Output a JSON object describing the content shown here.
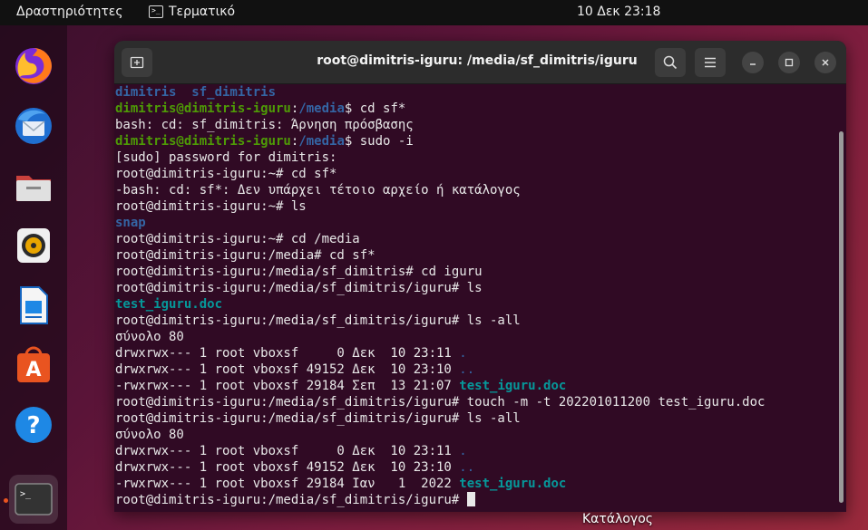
{
  "topbar": {
    "activities": "Δραστηριότητες",
    "app": "Τερματικό",
    "clock": "10 Δεκ  23:18"
  },
  "dock": {
    "items": [
      "firefox-icon",
      "thunderbird-icon",
      "files-icon",
      "rhythmbox-icon",
      "libreoffice-writer-icon",
      "software-icon",
      "help-icon",
      "terminal-icon"
    ]
  },
  "window": {
    "title": "root@dimitris-iguru: /media/sf_dimitris/iguru"
  },
  "terminal": {
    "lines": [
      [
        [
          "dimitris  sf_dimitris",
          "dir"
        ]
      ],
      [
        [
          "dimitris@dimitris-iguru",
          "user"
        ],
        [
          ":",
          "plain"
        ],
        [
          "/media",
          "path"
        ],
        [
          "$ cd sf*",
          "plain"
        ]
      ],
      [
        [
          "bash: cd: sf_dimitris: Άρνηση πρόσβασης",
          "plain"
        ]
      ],
      [
        [
          "dimitris@dimitris-iguru",
          "user"
        ],
        [
          ":",
          "plain"
        ],
        [
          "/media",
          "path"
        ],
        [
          "$ sudo -i",
          "plain"
        ]
      ],
      [
        [
          "[sudo] password for dimitris:",
          "plain"
        ]
      ],
      [
        [
          "root@dimitris-iguru:~# cd sf*",
          "plain"
        ]
      ],
      [
        [
          "-bash: cd: sf*: Δεν υπάρχει τέτοιο αρχείο ή κατάλογος",
          "plain"
        ]
      ],
      [
        [
          "root@dimitris-iguru:~# ls",
          "plain"
        ]
      ],
      [
        [
          "snap",
          "dir"
        ]
      ],
      [
        [
          "root@dimitris-iguru:~# cd /media",
          "plain"
        ]
      ],
      [
        [
          "root@dimitris-iguru:/media# cd sf*",
          "plain"
        ]
      ],
      [
        [
          "root@dimitris-iguru:/media/sf_dimitris# cd iguru",
          "plain"
        ]
      ],
      [
        [
          "root@dimitris-iguru:/media/sf_dimitris/iguru# ls",
          "plain"
        ]
      ],
      [
        [
          "test_iguru.doc",
          "file"
        ]
      ],
      [
        [
          "root@dimitris-iguru:/media/sf_dimitris/iguru# ls -all",
          "plain"
        ]
      ],
      [
        [
          "σύνολο 80",
          "plain"
        ]
      ],
      [
        [
          "drwxrwx--- 1 root vboxsf     0 Δεκ  10 23:11 ",
          "plain"
        ],
        [
          ".",
          "other"
        ]
      ],
      [
        [
          "drwxrwx--- 1 root vboxsf 49152 Δεκ  10 23:10 ",
          "plain"
        ],
        [
          "..",
          "other"
        ]
      ],
      [
        [
          "-rwxrwx--- 1 root vboxsf 29184 Σεπ  13 21:07 ",
          "plain"
        ],
        [
          "test_iguru.doc",
          "file"
        ]
      ],
      [
        [
          "root@dimitris-iguru:/media/sf_dimitris/iguru# touch -m -t 202201011200 test_iguru.doc",
          "plain"
        ]
      ],
      [
        [
          "root@dimitris-iguru:/media/sf_dimitris/iguru# ls -all",
          "plain"
        ]
      ],
      [
        [
          "σύνολο 80",
          "plain"
        ]
      ],
      [
        [
          "drwxrwx--- 1 root vboxsf     0 Δεκ  10 23:11 ",
          "plain"
        ],
        [
          ".",
          "other"
        ]
      ],
      [
        [
          "drwxrwx--- 1 root vboxsf 49152 Δεκ  10 23:10 ",
          "plain"
        ],
        [
          "..",
          "other"
        ]
      ],
      [
        [
          "-rwxrwx--- 1 root vboxsf 29184 Ιαν   1  2022 ",
          "plain"
        ],
        [
          "test_iguru.doc",
          "file"
        ]
      ],
      [
        [
          "root@dimitris-iguru:/media/sf_dimitris/iguru# ",
          "plain"
        ]
      ]
    ]
  },
  "desktop": {
    "label": "Κατάλογος"
  },
  "colors": {
    "terminal_bg": "#300a24",
    "user_prompt": "#4e9a06",
    "path": "#3465a4",
    "file": "#06989a",
    "accent": "#e95420"
  }
}
